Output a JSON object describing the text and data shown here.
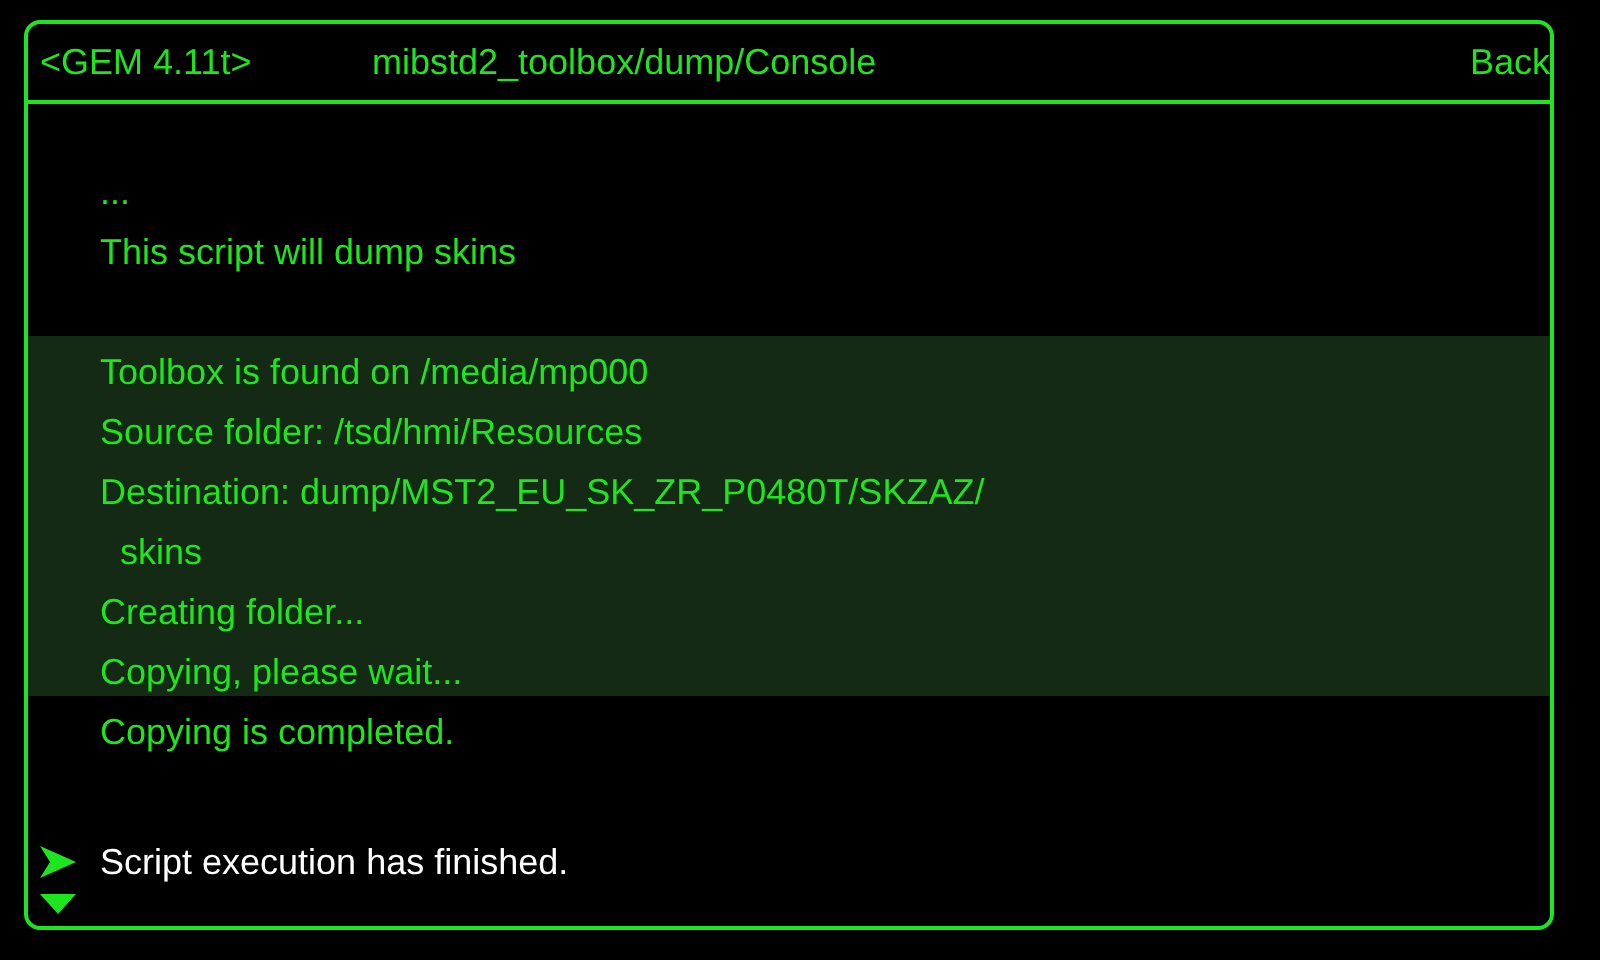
{
  "header": {
    "version": "<GEM 4.11t>",
    "path": "mibstd2_toolbox/dump/Console",
    "back": "Back"
  },
  "lines": [
    {
      "kind": "text",
      "text": "...",
      "highlighted": false
    },
    {
      "kind": "text",
      "text": "This script will dump skins",
      "highlighted": false
    },
    {
      "kind": "blank",
      "highlighted": false
    },
    {
      "kind": "text",
      "text": "Toolbox is found on /media/mp000",
      "highlighted": true
    },
    {
      "kind": "text",
      "text": "Source folder: /tsd/hmi/Resources",
      "highlighted": true
    },
    {
      "kind": "text",
      "text": "Destination: dump/MST2_EU_SK_ZR_P0480T/SKZAZ/",
      "highlighted": true
    },
    {
      "kind": "continuation",
      "text": "skins",
      "highlighted": true
    },
    {
      "kind": "text",
      "text": "Creating folder...",
      "highlighted": true
    },
    {
      "kind": "text",
      "text": "Copying, please wait...",
      "highlighted": true
    },
    {
      "kind": "text",
      "text": "Copying is completed.",
      "highlighted": false
    },
    {
      "kind": "blank",
      "highlighted": false
    },
    {
      "kind": "status",
      "text": "Script execution has finished.",
      "highlighted": false
    }
  ]
}
